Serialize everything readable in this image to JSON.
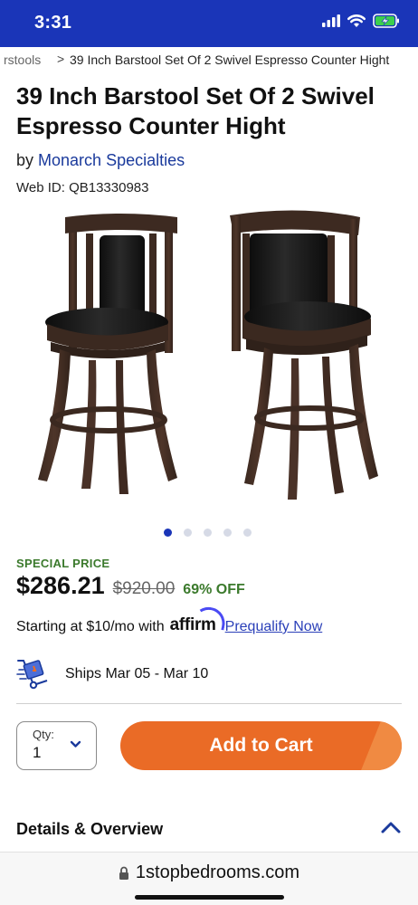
{
  "status_bar": {
    "time": "3:31",
    "icons": [
      "signal-icon",
      "wifi-icon",
      "battery-charging-icon"
    ],
    "bg_color": "#1a35b8",
    "battery_color": "#3ccf4e"
  },
  "breadcrumb": {
    "previous": "rstools",
    "separator": ">",
    "current": "39 Inch Barstool Set Of 2 Swivel Espresso Counter Hight"
  },
  "product": {
    "title": "39 Inch Barstool Set Of 2 Swivel Espresso Counter Hight",
    "by_prefix": "by",
    "brand": "Monarch Specialties",
    "web_id": "Web ID: QB13330983",
    "image_count": 5,
    "active_image": 1
  },
  "pricing": {
    "special_label": "SPECIAL PRICE",
    "price": "$286.21",
    "original_price": "$920.00",
    "discount": "69% OFF",
    "accent_green": "#3b7a2c"
  },
  "financing": {
    "text": "Starting at $10/mo with",
    "brand": "affirm",
    "link": "Prequalify Now"
  },
  "shipping": {
    "icon": "delivery-truck-icon",
    "text": "Ships Mar 05 - Mar 10"
  },
  "cart": {
    "qty_label": "Qty:",
    "qty_value": "1",
    "add_label": "Add to Cart",
    "button_color": "#ea6b26"
  },
  "details": {
    "title": "Details & Overview",
    "expanded": true
  },
  "browser": {
    "url": "1stopbedrooms.com",
    "lock_icon": "lock-icon"
  }
}
